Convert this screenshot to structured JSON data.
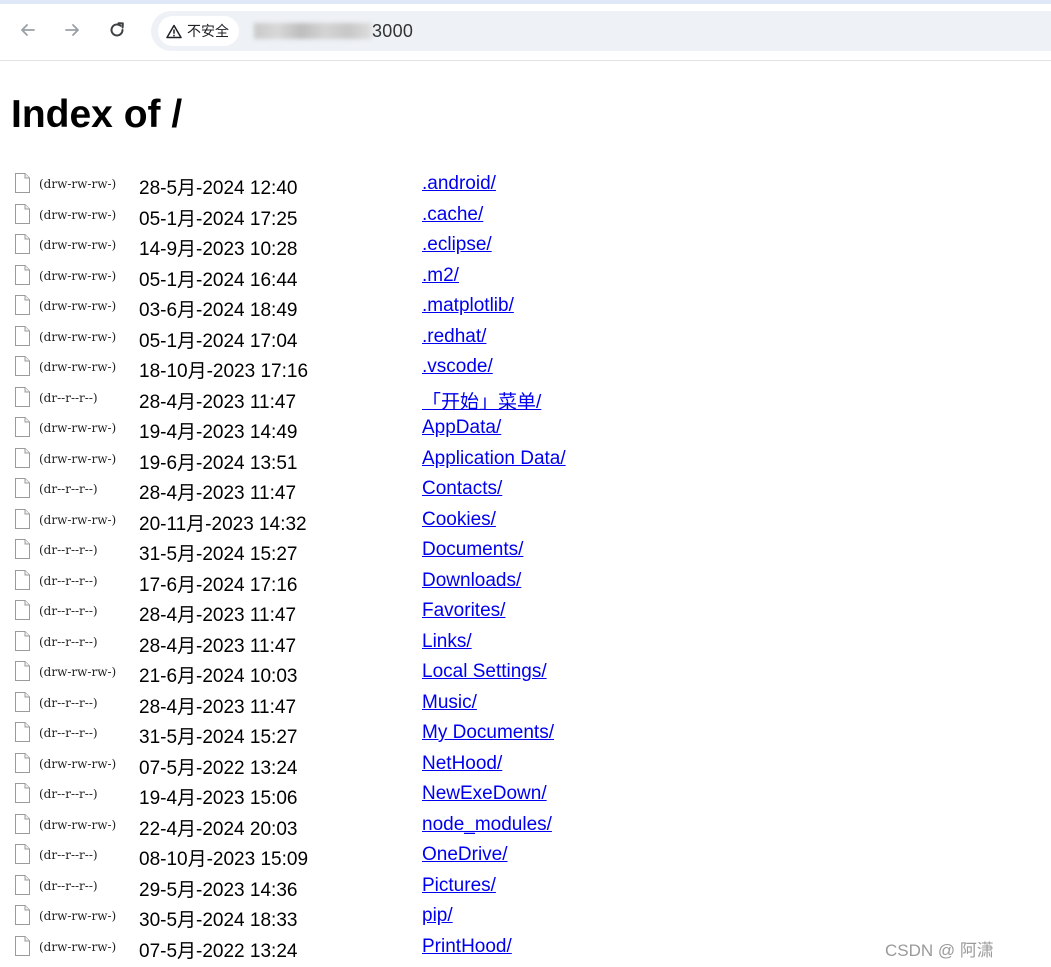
{
  "browser": {
    "security_label": "不安全",
    "url_visible": "3000"
  },
  "page": {
    "title": "Index of /"
  },
  "entries": [
    {
      "perm": "(drw-rw-rw-)",
      "date": "28-5月-2024 12:40",
      "name": ".android/"
    },
    {
      "perm": "(drw-rw-rw-)",
      "date": "05-1月-2024 17:25",
      "name": ".cache/"
    },
    {
      "perm": "(drw-rw-rw-)",
      "date": "14-9月-2023 10:28",
      "name": ".eclipse/"
    },
    {
      "perm": "(drw-rw-rw-)",
      "date": "05-1月-2024 16:44",
      "name": ".m2/"
    },
    {
      "perm": "(drw-rw-rw-)",
      "date": "03-6月-2024 18:49",
      "name": ".matplotlib/"
    },
    {
      "perm": "(drw-rw-rw-)",
      "date": "05-1月-2024 17:04",
      "name": ".redhat/"
    },
    {
      "perm": "(drw-rw-rw-)",
      "date": "18-10月-2023 17:16",
      "name": ".vscode/"
    },
    {
      "perm": "(dr--r--r--)",
      "date": "28-4月-2023 11:47",
      "name": "「开始」菜单/"
    },
    {
      "perm": "(drw-rw-rw-)",
      "date": "19-4月-2023 14:49",
      "name": "AppData/"
    },
    {
      "perm": "(drw-rw-rw-)",
      "date": "19-6月-2024 13:51",
      "name": "Application Data/"
    },
    {
      "perm": "(dr--r--r--)",
      "date": "28-4月-2023 11:47",
      "name": "Contacts/"
    },
    {
      "perm": "(drw-rw-rw-)",
      "date": "20-11月-2023 14:32",
      "name": "Cookies/"
    },
    {
      "perm": "(dr--r--r--)",
      "date": "31-5月-2024 15:27",
      "name": "Documents/"
    },
    {
      "perm": "(dr--r--r--)",
      "date": "17-6月-2024 17:16",
      "name": "Downloads/"
    },
    {
      "perm": "(dr--r--r--)",
      "date": "28-4月-2023 11:47",
      "name": "Favorites/"
    },
    {
      "perm": "(dr--r--r--)",
      "date": "28-4月-2023 11:47",
      "name": "Links/"
    },
    {
      "perm": "(drw-rw-rw-)",
      "date": "21-6月-2024 10:03",
      "name": "Local Settings/"
    },
    {
      "perm": "(dr--r--r--)",
      "date": "28-4月-2023 11:47",
      "name": "Music/"
    },
    {
      "perm": "(dr--r--r--)",
      "date": "31-5月-2024 15:27",
      "name": "My Documents/"
    },
    {
      "perm": "(drw-rw-rw-)",
      "date": "07-5月-2022 13:24",
      "name": "NetHood/"
    },
    {
      "perm": "(dr--r--r--)",
      "date": "19-4月-2023 15:06",
      "name": "NewExeDown/"
    },
    {
      "perm": "(drw-rw-rw-)",
      "date": "22-4月-2024 20:03",
      "name": "node_modules/"
    },
    {
      "perm": "(dr--r--r--)",
      "date": "08-10月-2023 15:09",
      "name": "OneDrive/"
    },
    {
      "perm": "(dr--r--r--)",
      "date": "29-5月-2023 14:36",
      "name": "Pictures/"
    },
    {
      "perm": "(drw-rw-rw-)",
      "date": "30-5月-2024 18:33",
      "name": "pip/"
    },
    {
      "perm": "(drw-rw-rw-)",
      "date": "07-5月-2022 13:24",
      "name": "PrintHood/"
    }
  ],
  "watermark": "CSDN @    阿潇",
  "icons": {
    "back": "arrow-left-icon",
    "forward": "arrow-right-icon",
    "reload": "reload-icon",
    "warning": "warning-triangle-icon",
    "entry": "file-icon"
  },
  "colors": {
    "link": "#0000ee",
    "omnibox_bg": "#eef1f6"
  }
}
